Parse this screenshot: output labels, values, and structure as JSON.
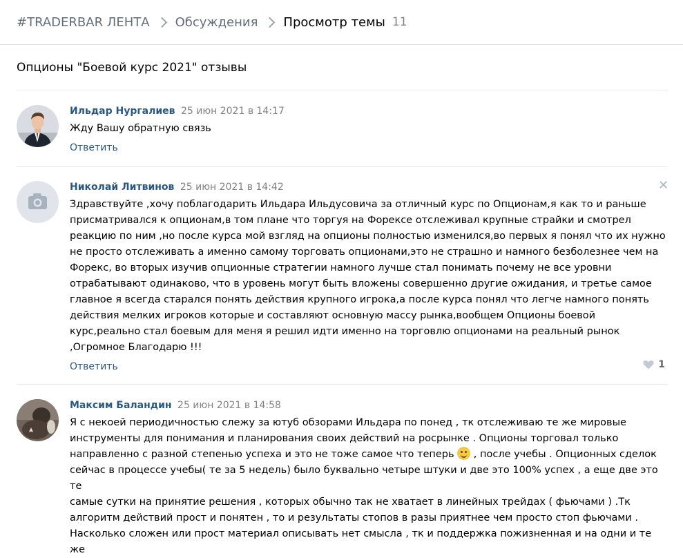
{
  "breadcrumb": {
    "group": "#TRADERBAR ЛЕНТА",
    "section": "Обсуждения",
    "current": "Просмотр темы",
    "count": "11"
  },
  "topic": {
    "title": "Опционы \"Боевой курс 2021\" отзывы"
  },
  "posts": [
    {
      "author": "Ильдар Нургалиев",
      "date": "25 июн 2021 в 14:17",
      "text": "Жду Вашу обратную связь",
      "reply": "Ответить"
    },
    {
      "author": "Николай Литвинов",
      "date": "25 июн 2021 в 14:42",
      "text": "Здравствуйте ,хочу поблагодарить Ильдара Ильдусовича за отличный курс по Опционам,я как то и раньше\nприсматривался к опционам,в том плане что торгуя на Форексе отслеживал крупные страйки и смотрел\nреакцию по ним ,но после курса мой взгляд на опционы полностью изменился,во первых я понял что их нужно\nне просто отслеживать а именно самому торговать опционами,это не страшно и намного безболезнее чем на\nФорекс, во вторых изучив опционные стратегии намного лучше стал понимать почему не все уровни\nотрабатывают одинаково, что в уровень могут быть вложены совершенно другие ожидания, и третье самое\nглавное я всегда старался понять действия крупного игрока,а после курса понял что легче намного понять\nдействия мелких игроков которые и составляют основную массу рынка,вообщем Опционы боевой\nкурс,реально стал боевым для меня я решил идти именно на торговлю опционами на реальный рынок\n,Огромное Благодарю !!!",
      "reply": "Ответить",
      "likes": "1"
    },
    {
      "author": "Максим Баландин",
      "date": "25 июн 2021 в 14:58",
      "text_before_emoji": "Я с некоей периодичностью слежу за ютуб обзорами Ильдара по понед , тк отслеживаю те же мировые\nинструменты для понимания и планирования своих действий на росрынке . Опционы торговал только\nнаправленно с разной степенью успеха и это не тоже самое что теперь ",
      "text_after_emoji": " , после учебы . Опционных сделок\nсейчас в процессе учебы( те за 5 недель) было буквально четыре штуки и две это 100% успех , а еще две это те\nсамые сутки на принятие решения , которых обычно так не хватает в линейных трейдах ( фьючами ) .Тк\nалгоритм действий прост и понятен , то и результаты стопов в разы приятнее чем просто стоп фьючами .\nНасколько сложен или прост материал описывать нет смысла , тк и поддержка пожизненная и на одни и те же"
    }
  ],
  "icons": {
    "chevron": "chevron-right-icon",
    "close": "close-icon",
    "like": "heart-icon",
    "camera": "camera-icon",
    "emoji": "smile-emoji-icon"
  },
  "colors": {
    "link": "#2a5885",
    "muted": "#828282",
    "divider": "#e7e8ec"
  }
}
